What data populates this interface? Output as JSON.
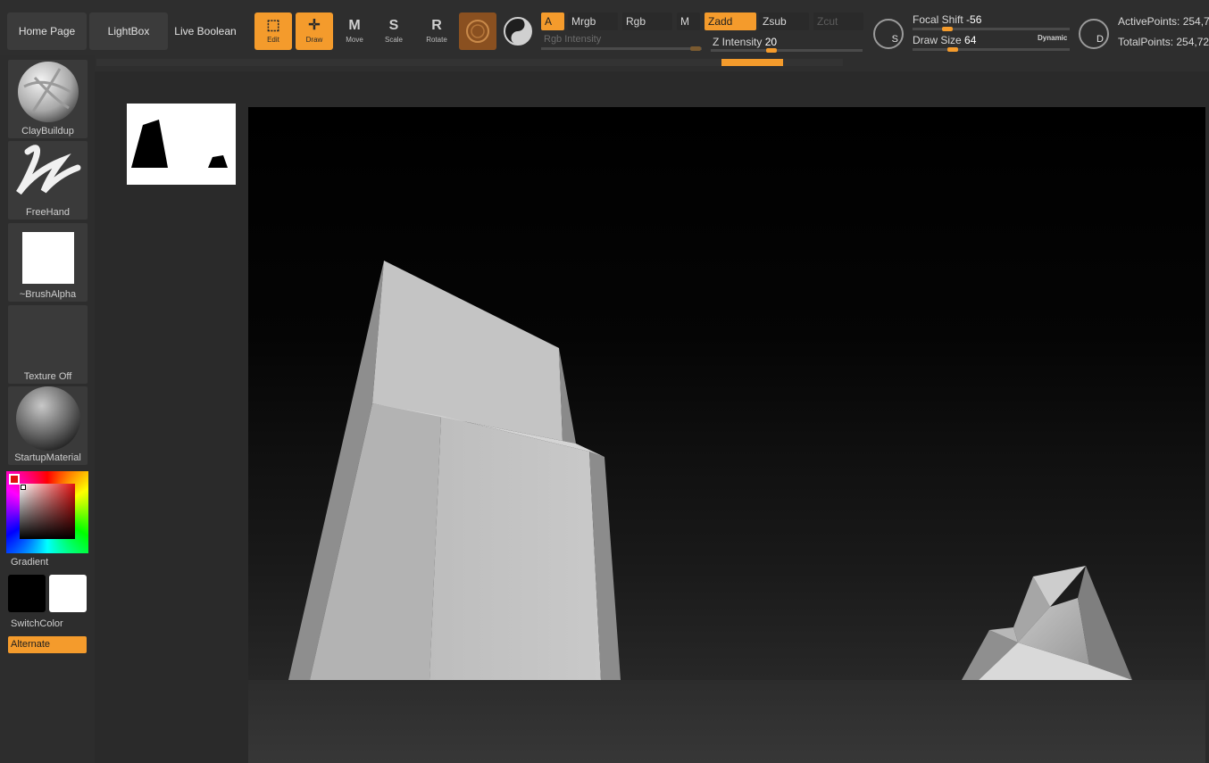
{
  "nav": {
    "home": "Home Page",
    "lightbox": "LightBox",
    "live_boolean": "Live Boolean"
  },
  "tools": {
    "edit": {
      "label": "Edit",
      "icon": "edit-icon"
    },
    "draw": {
      "label": "Draw",
      "icon": "draw-icon"
    },
    "move": {
      "label": "Move",
      "icon": "move-icon"
    },
    "scale": {
      "label": "Scale",
      "icon": "scale-icon"
    },
    "rotate": {
      "label": "Rotate",
      "icon": "rotate-icon"
    }
  },
  "color_mode": {
    "a": "A",
    "mrgb": "Mrgb",
    "rgb": "Rgb",
    "m": "M",
    "rgb_intensity": "Rgb Intensity"
  },
  "z_mode": {
    "zadd": "Zadd",
    "zsub": "Zsub",
    "zcut": "Zcut",
    "z_intensity_label": "Z Intensity",
    "z_intensity_value": "20",
    "z_intensity_fraction": 0.2
  },
  "brush_settings": {
    "focal_shift_label": "Focal Shift",
    "focal_shift_value": "-56",
    "draw_size_label": "Draw Size",
    "draw_size_value": "64",
    "dynamic": "Dynamic",
    "sym_s": "S",
    "sym_d": "D"
  },
  "stats": {
    "active_points": "ActivePoints: 254,7",
    "total_points": "TotalPoints: 254,72"
  },
  "progress": {
    "start_fraction": 0.837,
    "end_fraction": 0.92
  },
  "tray": {
    "brush": "ClayBuildup",
    "stroke": "FreeHand",
    "alpha": "~BrushAlpha",
    "texture": "Texture Off",
    "material": "StartupMaterial",
    "gradient": "Gradient",
    "switch_color": "SwitchColor",
    "alternate": "Alternate"
  },
  "colors": {
    "accent": "#f49b2c",
    "main_color": "#000000",
    "secondary_color": "#ffffff"
  }
}
